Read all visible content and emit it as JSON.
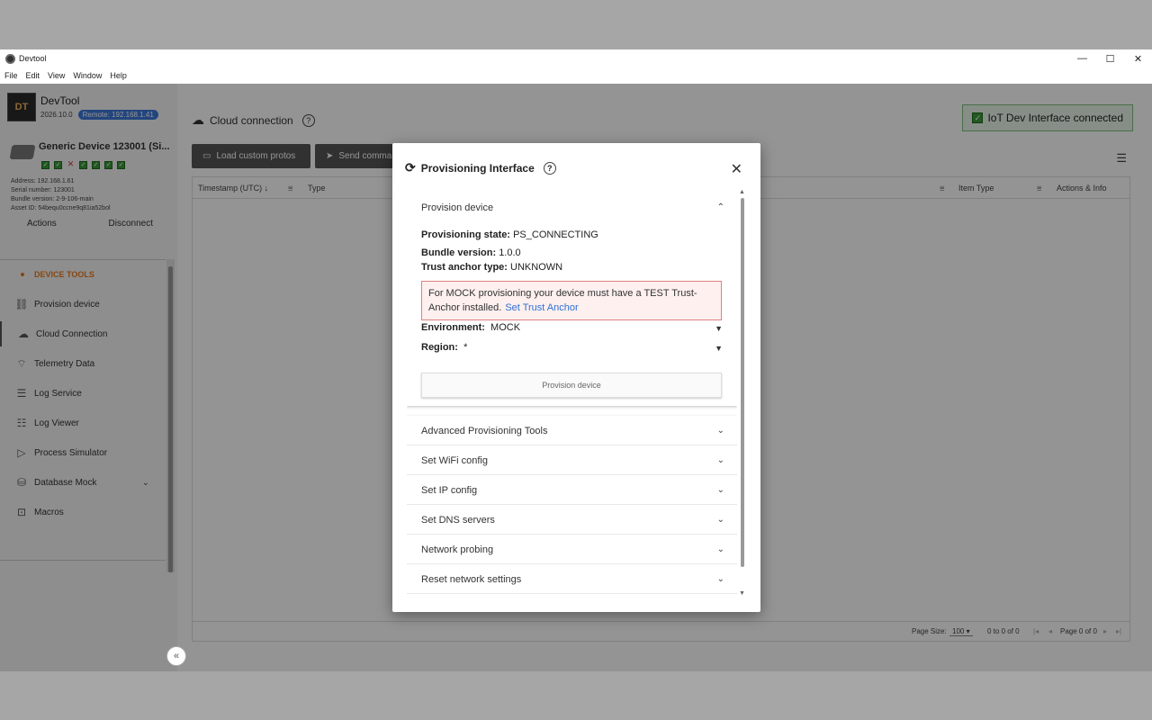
{
  "window": {
    "title": "Devtool",
    "controls": [
      "—",
      "☐",
      "✕"
    ],
    "menu": [
      "File",
      "Edit",
      "View",
      "Window",
      "Help"
    ]
  },
  "brand": {
    "logo": "DT",
    "name": "DevTool",
    "version": "2026.10.0",
    "remote": "Remote: 192.168.1.41"
  },
  "device": {
    "name": "Generic Device 123001 (Si...",
    "checks": [
      "ok",
      "ok",
      "fail",
      "ok",
      "ok",
      "ok",
      "ok"
    ],
    "address": "Address: 192.168.1.61",
    "serial": "Serial number: 123001",
    "bundle": "Bundle version: 2-9-106-main",
    "asset": "Asset ID: 54bequ0ccne9q81ia52bol",
    "actions_label": "Actions",
    "disconnect_label": "Disconnect"
  },
  "nav": {
    "header": "DEVICE TOOLS",
    "items": [
      {
        "label": "Provision device",
        "icon": "link-icon"
      },
      {
        "label": "Cloud Connection",
        "icon": "cloud-icon"
      },
      {
        "label": "Telemetry Data",
        "icon": "wifi-icon"
      },
      {
        "label": "Log Service",
        "icon": "list-icon"
      },
      {
        "label": "Log Viewer",
        "icon": "list-check-icon"
      },
      {
        "label": "Process Simulator",
        "icon": "play-icon"
      },
      {
        "label": "Database Mock",
        "icon": "database-icon"
      },
      {
        "label": "Macros",
        "icon": "terminal-icon"
      }
    ]
  },
  "main": {
    "title": "Cloud connection",
    "status": "IoT Dev Interface connected",
    "load_protos": "Load custom protos",
    "send_command": "Send comma",
    "columns": {
      "timestamp": "Timestamp (UTC)",
      "type": "Type",
      "item_type": "Item Type",
      "actions_info": "Actions & Info"
    },
    "footer": {
      "page_size_label": "Page Size:",
      "page_size": "100",
      "range": "0 to 0 of 0",
      "page": "Page 0 of 0"
    }
  },
  "dialog": {
    "title": "Provisioning Interface",
    "section_title": "Provision device",
    "state_label": "Provisioning state:",
    "state_value": "PS_CONNECTING",
    "bundle_label": "Bundle version:",
    "bundle_value": "1.0.0",
    "anchor_label": "Trust anchor type:",
    "anchor_value": "UNKNOWN",
    "alert_text": "For MOCK provisioning your device must have a TEST Trust-Anchor installed.",
    "alert_link": "Set Trust Anchor",
    "env_label": "Environment:",
    "env_value": "MOCK",
    "region_label": "Region:",
    "region_value": "*",
    "provision_button": "Provision device",
    "accordions": [
      "Advanced Provisioning Tools",
      "Set WiFi config",
      "Set IP config",
      "Set DNS servers",
      "Network probing",
      "Reset network settings"
    ]
  },
  "colors": {
    "accent_orange": "#e87a1e",
    "link_blue": "#2f6fd6",
    "status_green": "#3a9a3a",
    "alert_red": "#e08080"
  }
}
